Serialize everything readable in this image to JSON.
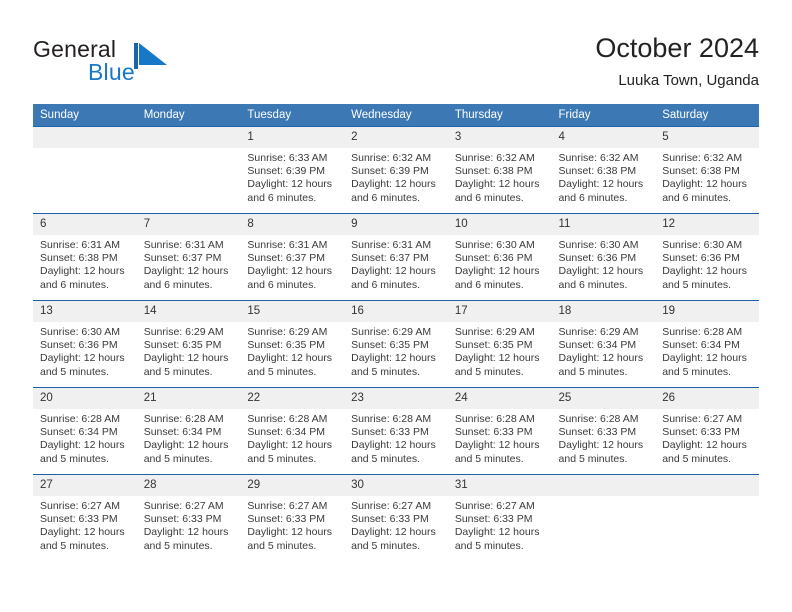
{
  "brand": {
    "name_part1": "General",
    "name_part2": "Blue",
    "flag_icon": "blue-triangle-flag-icon",
    "colors": {
      "dark": "#231f20",
      "blue": "#1878c8"
    }
  },
  "header": {
    "title": "October 2024",
    "subtitle": "Luuka Town, Uganda"
  },
  "theme": {
    "header_blue": "#3c78b4",
    "rule_blue": "#1c63ab",
    "daynum_bg": "#f0f0f0"
  },
  "calendar": {
    "weekday_headers": [
      "Sunday",
      "Monday",
      "Tuesday",
      "Wednesday",
      "Thursday",
      "Friday",
      "Saturday"
    ],
    "weeks": [
      [
        {
          "day": "",
          "empty": true,
          "sunrise": "",
          "sunset": "",
          "daylight_line1": "",
          "daylight_line2": ""
        },
        {
          "day": "",
          "empty": true,
          "sunrise": "",
          "sunset": "",
          "daylight_line1": "",
          "daylight_line2": ""
        },
        {
          "day": "1",
          "sunrise": "Sunrise: 6:33 AM",
          "sunset": "Sunset: 6:39 PM",
          "daylight_line1": "Daylight: 12 hours",
          "daylight_line2": "and 6 minutes."
        },
        {
          "day": "2",
          "sunrise": "Sunrise: 6:32 AM",
          "sunset": "Sunset: 6:39 PM",
          "daylight_line1": "Daylight: 12 hours",
          "daylight_line2": "and 6 minutes."
        },
        {
          "day": "3",
          "sunrise": "Sunrise: 6:32 AM",
          "sunset": "Sunset: 6:38 PM",
          "daylight_line1": "Daylight: 12 hours",
          "daylight_line2": "and 6 minutes."
        },
        {
          "day": "4",
          "sunrise": "Sunrise: 6:32 AM",
          "sunset": "Sunset: 6:38 PM",
          "daylight_line1": "Daylight: 12 hours",
          "daylight_line2": "and 6 minutes."
        },
        {
          "day": "5",
          "sunrise": "Sunrise: 6:32 AM",
          "sunset": "Sunset: 6:38 PM",
          "daylight_line1": "Daylight: 12 hours",
          "daylight_line2": "and 6 minutes."
        }
      ],
      [
        {
          "day": "6",
          "sunrise": "Sunrise: 6:31 AM",
          "sunset": "Sunset: 6:38 PM",
          "daylight_line1": "Daylight: 12 hours",
          "daylight_line2": "and 6 minutes."
        },
        {
          "day": "7",
          "sunrise": "Sunrise: 6:31 AM",
          "sunset": "Sunset: 6:37 PM",
          "daylight_line1": "Daylight: 12 hours",
          "daylight_line2": "and 6 minutes."
        },
        {
          "day": "8",
          "sunrise": "Sunrise: 6:31 AM",
          "sunset": "Sunset: 6:37 PM",
          "daylight_line1": "Daylight: 12 hours",
          "daylight_line2": "and 6 minutes."
        },
        {
          "day": "9",
          "sunrise": "Sunrise: 6:31 AM",
          "sunset": "Sunset: 6:37 PM",
          "daylight_line1": "Daylight: 12 hours",
          "daylight_line2": "and 6 minutes."
        },
        {
          "day": "10",
          "sunrise": "Sunrise: 6:30 AM",
          "sunset": "Sunset: 6:36 PM",
          "daylight_line1": "Daylight: 12 hours",
          "daylight_line2": "and 6 minutes."
        },
        {
          "day": "11",
          "sunrise": "Sunrise: 6:30 AM",
          "sunset": "Sunset: 6:36 PM",
          "daylight_line1": "Daylight: 12 hours",
          "daylight_line2": "and 6 minutes."
        },
        {
          "day": "12",
          "sunrise": "Sunrise: 6:30 AM",
          "sunset": "Sunset: 6:36 PM",
          "daylight_line1": "Daylight: 12 hours",
          "daylight_line2": "and 5 minutes."
        }
      ],
      [
        {
          "day": "13",
          "sunrise": "Sunrise: 6:30 AM",
          "sunset": "Sunset: 6:36 PM",
          "daylight_line1": "Daylight: 12 hours",
          "daylight_line2": "and 5 minutes."
        },
        {
          "day": "14",
          "sunrise": "Sunrise: 6:29 AM",
          "sunset": "Sunset: 6:35 PM",
          "daylight_line1": "Daylight: 12 hours",
          "daylight_line2": "and 5 minutes."
        },
        {
          "day": "15",
          "sunrise": "Sunrise: 6:29 AM",
          "sunset": "Sunset: 6:35 PM",
          "daylight_line1": "Daylight: 12 hours",
          "daylight_line2": "and 5 minutes."
        },
        {
          "day": "16",
          "sunrise": "Sunrise: 6:29 AM",
          "sunset": "Sunset: 6:35 PM",
          "daylight_line1": "Daylight: 12 hours",
          "daylight_line2": "and 5 minutes."
        },
        {
          "day": "17",
          "sunrise": "Sunrise: 6:29 AM",
          "sunset": "Sunset: 6:35 PM",
          "daylight_line1": "Daylight: 12 hours",
          "daylight_line2": "and 5 minutes."
        },
        {
          "day": "18",
          "sunrise": "Sunrise: 6:29 AM",
          "sunset": "Sunset: 6:34 PM",
          "daylight_line1": "Daylight: 12 hours",
          "daylight_line2": "and 5 minutes."
        },
        {
          "day": "19",
          "sunrise": "Sunrise: 6:28 AM",
          "sunset": "Sunset: 6:34 PM",
          "daylight_line1": "Daylight: 12 hours",
          "daylight_line2": "and 5 minutes."
        }
      ],
      [
        {
          "day": "20",
          "sunrise": "Sunrise: 6:28 AM",
          "sunset": "Sunset: 6:34 PM",
          "daylight_line1": "Daylight: 12 hours",
          "daylight_line2": "and 5 minutes."
        },
        {
          "day": "21",
          "sunrise": "Sunrise: 6:28 AM",
          "sunset": "Sunset: 6:34 PM",
          "daylight_line1": "Daylight: 12 hours",
          "daylight_line2": "and 5 minutes."
        },
        {
          "day": "22",
          "sunrise": "Sunrise: 6:28 AM",
          "sunset": "Sunset: 6:34 PM",
          "daylight_line1": "Daylight: 12 hours",
          "daylight_line2": "and 5 minutes."
        },
        {
          "day": "23",
          "sunrise": "Sunrise: 6:28 AM",
          "sunset": "Sunset: 6:33 PM",
          "daylight_line1": "Daylight: 12 hours",
          "daylight_line2": "and 5 minutes."
        },
        {
          "day": "24",
          "sunrise": "Sunrise: 6:28 AM",
          "sunset": "Sunset: 6:33 PM",
          "daylight_line1": "Daylight: 12 hours",
          "daylight_line2": "and 5 minutes."
        },
        {
          "day": "25",
          "sunrise": "Sunrise: 6:28 AM",
          "sunset": "Sunset: 6:33 PM",
          "daylight_line1": "Daylight: 12 hours",
          "daylight_line2": "and 5 minutes."
        },
        {
          "day": "26",
          "sunrise": "Sunrise: 6:27 AM",
          "sunset": "Sunset: 6:33 PM",
          "daylight_line1": "Daylight: 12 hours",
          "daylight_line2": "and 5 minutes."
        }
      ],
      [
        {
          "day": "27",
          "sunrise": "Sunrise: 6:27 AM",
          "sunset": "Sunset: 6:33 PM",
          "daylight_line1": "Daylight: 12 hours",
          "daylight_line2": "and 5 minutes."
        },
        {
          "day": "28",
          "sunrise": "Sunrise: 6:27 AM",
          "sunset": "Sunset: 6:33 PM",
          "daylight_line1": "Daylight: 12 hours",
          "daylight_line2": "and 5 minutes."
        },
        {
          "day": "29",
          "sunrise": "Sunrise: 6:27 AM",
          "sunset": "Sunset: 6:33 PM",
          "daylight_line1": "Daylight: 12 hours",
          "daylight_line2": "and 5 minutes."
        },
        {
          "day": "30",
          "sunrise": "Sunrise: 6:27 AM",
          "sunset": "Sunset: 6:33 PM",
          "daylight_line1": "Daylight: 12 hours",
          "daylight_line2": "and 5 minutes."
        },
        {
          "day": "31",
          "sunrise": "Sunrise: 6:27 AM",
          "sunset": "Sunset: 6:33 PM",
          "daylight_line1": "Daylight: 12 hours",
          "daylight_line2": "and 5 minutes."
        },
        {
          "day": "",
          "empty": true,
          "sunrise": "",
          "sunset": "",
          "daylight_line1": "",
          "daylight_line2": ""
        },
        {
          "day": "",
          "empty": true,
          "sunrise": "",
          "sunset": "",
          "daylight_line1": "",
          "daylight_line2": ""
        }
      ]
    ]
  }
}
